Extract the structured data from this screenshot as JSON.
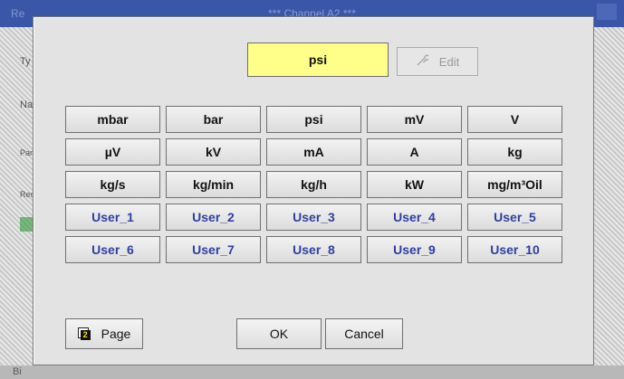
{
  "background": {
    "window_title": "*** Channel A2 ***"
  },
  "dialog": {
    "selected_unit": "psi",
    "edit_label": "Edit",
    "unit_rows": [
      [
        "mbar",
        "bar",
        "psi",
        "mV",
        "V"
      ],
      [
        "µV",
        "kV",
        "mA",
        "A",
        "kg"
      ],
      [
        "kg/s",
        "kg/min",
        "kg/h",
        "kW",
        "mg/m³Oil"
      ],
      [
        "User_1",
        "User_2",
        "User_3",
        "User_4",
        "User_5"
      ],
      [
        "User_6",
        "User_7",
        "User_8",
        "User_9",
        "User_10"
      ]
    ],
    "page_label": "Page",
    "page_icon_number": "2",
    "ok_label": "OK",
    "cancel_label": "Cancel"
  },
  "colors": {
    "selected_bg": "#ffff8a",
    "user_unit_text": "#2f3fa0",
    "titlebar": "#3a56a8"
  },
  "icons": {
    "edit": "wrench-icon",
    "page": "page-icon"
  }
}
